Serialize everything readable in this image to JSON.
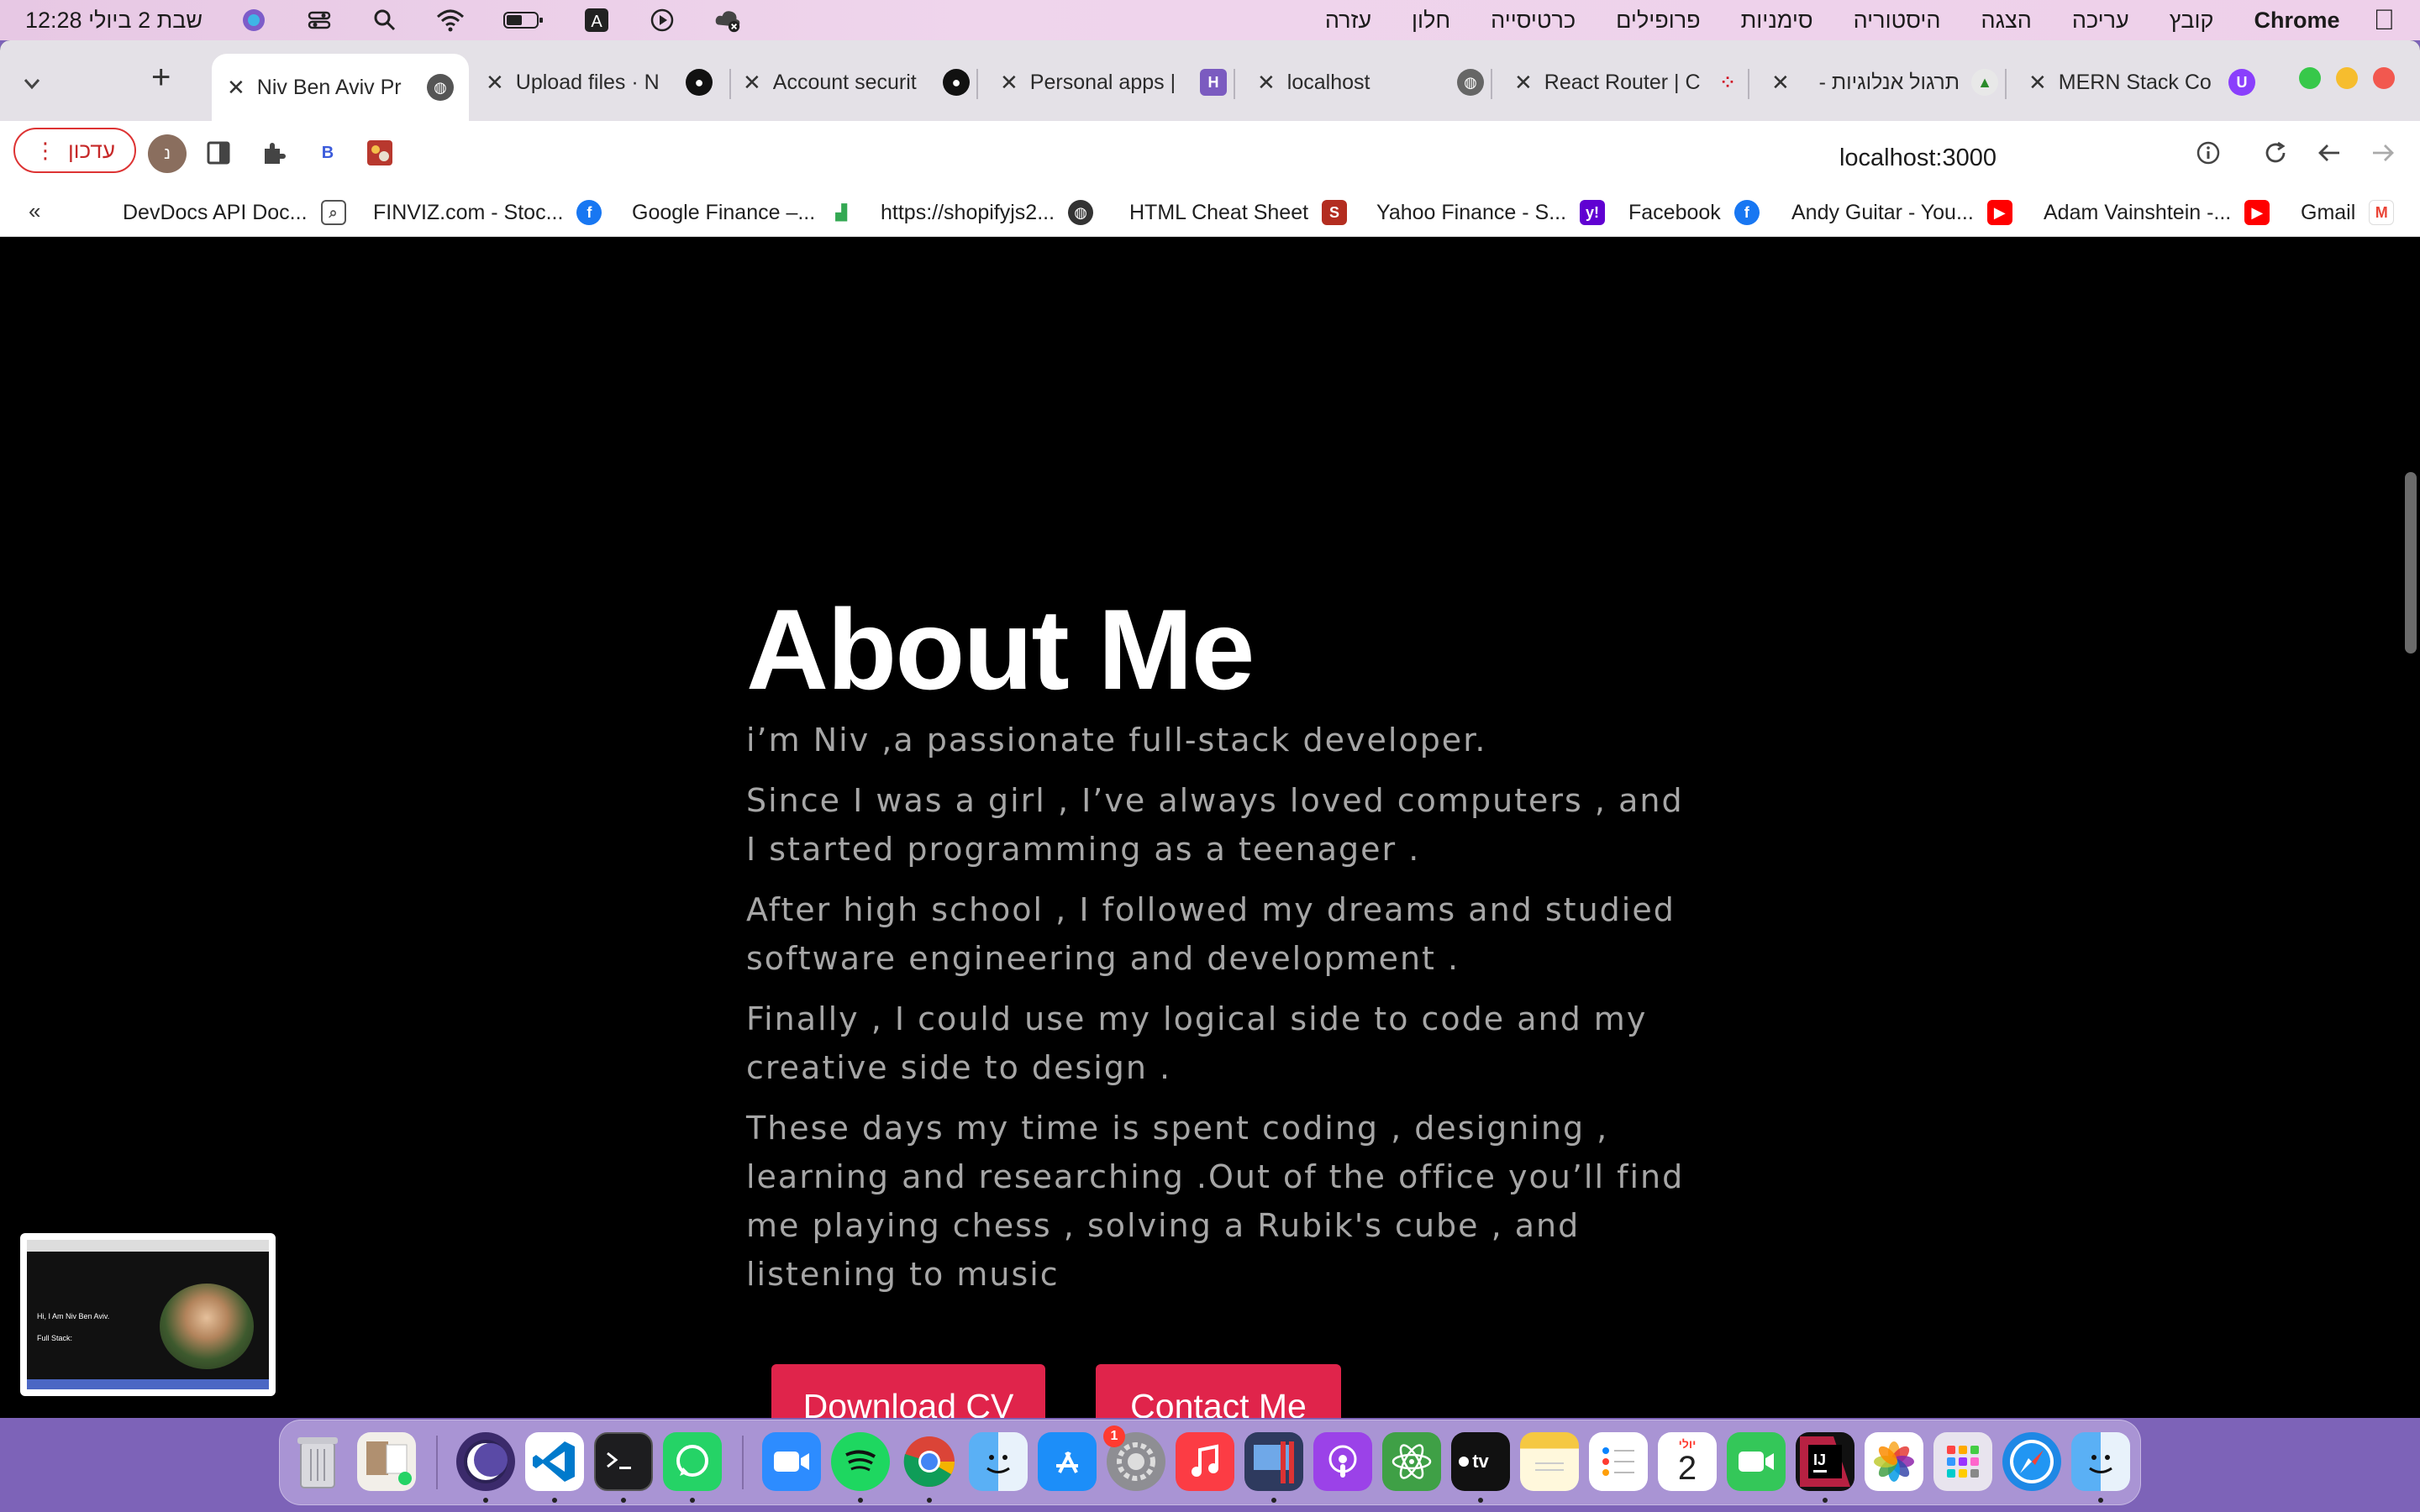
{
  "menubar": {
    "app_name": "Chrome",
    "items": [
      "קובץ",
      "עריכה",
      "הצגה",
      "היסטוריה",
      "סימניות",
      "פרופילים",
      "כרטיסייה",
      "חלון",
      "עזרה"
    ],
    "clock": "שבת 2 ביולי  12:28"
  },
  "tabs": [
    {
      "title": "Niv Ben Aviv Pr",
      "active": true
    },
    {
      "title": "Upload files · N",
      "active": false
    },
    {
      "title": "Account securit",
      "active": false
    },
    {
      "title": "Personal apps |",
      "active": false
    },
    {
      "title": "localhost",
      "active": false
    },
    {
      "title": "React Router | C",
      "active": false
    },
    {
      "title": "תרגול אנלוגיות -",
      "active": false
    },
    {
      "title": "MERN Stack Co",
      "active": false
    }
  ],
  "toolbar": {
    "update_label": "עדכון",
    "url": "localhost:3000",
    "profile_initial": "נ",
    "extension_letter": "B"
  },
  "bookmarks": [
    "DevDocs API Doc...",
    "FINVIZ.com - Stoc...",
    "Google Finance –...",
    "https://shopifyjs2...",
    "HTML Cheat Sheet",
    "Yahoo Finance - S...",
    "Facebook",
    "Andy Guitar - You...",
    "Adam Vainshtein -...",
    "Gmail"
  ],
  "bookmarks_more": "«",
  "page": {
    "heading": "About Me",
    "paragraphs": [
      "i’m Niv ,a passionate full-stack developer.",
      "Since I was a girl , I’ve always loved computers , and I started programming as a teenager .",
      "After high school , I followed my dreams and studied software engineering and development .",
      "Finally , I could use my logical side to code and my creative side to design .",
      "These days my time is spent coding , designing , learning and researching .Out of the office you’ll find me playing chess , solving a Rubik's cube , and listening to music"
    ],
    "download_cv": "Download CV",
    "contact_me": "Contact Me"
  },
  "pip": {
    "heading_text": "Hi, I Am Niv Ben Aviv.",
    "sub_text": "Full Stack:"
  },
  "dock": {
    "calendar_day": "2",
    "calendar_month": "יולי",
    "badge": "1"
  },
  "colors": {
    "accent_button": "#e0244b",
    "page_bg": "#000000",
    "paragraph_text": "#a6a6a6"
  }
}
